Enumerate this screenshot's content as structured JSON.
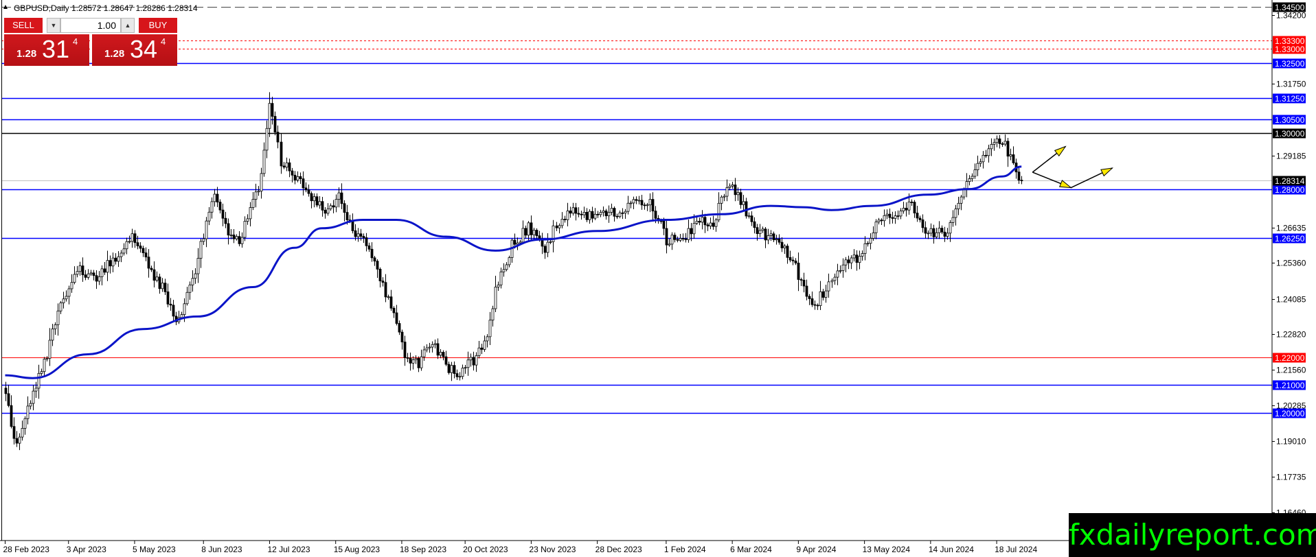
{
  "symbol_info": "GBPUSD,Daily  1.28572 1.28647 1.28286 1.28314",
  "trade_panel": {
    "sell_label": "SELL",
    "buy_label": "BUY",
    "lot_size": "1.00",
    "sell_price_small": "1.28",
    "sell_price_big": "31",
    "sell_price_sup": "4",
    "buy_price_small": "1.28",
    "buy_price_big": "34",
    "buy_price_sup": "4"
  },
  "watermark": "fxdailyreport.com",
  "colors": {
    "background": "#ffffff",
    "candle": "#000000",
    "moving_average": "#0a14c8",
    "level_blue": "#0000ff",
    "level_red": "#ff0000",
    "level_black": "#000000",
    "arrow_yellow": "#ffe800"
  },
  "chart_data": {
    "type": "candlestick",
    "symbol": "GBPUSD",
    "timeframe": "Daily",
    "ylim": [
      1.1545,
      1.3475
    ],
    "grid": false,
    "y_ticks": [
      1.342,
      1.3175,
      1.2918,
      1.2663,
      1.2536,
      1.2408,
      1.2282,
      1.2156,
      1.2028,
      1.1901,
      1.1773,
      1.1646
    ],
    "y_tick_labels": [
      "1.34200",
      "1.31750",
      "1.29185",
      "1.26635",
      "1.25360",
      "1.24085",
      "1.22820",
      "1.21560",
      "1.20285",
      "1.19010",
      "1.17735",
      "1.16460"
    ],
    "x_labels": [
      "28 Feb 2023",
      "3 Apr 2023",
      "5 May 2023",
      "8 Jun 2023",
      "12 Jul 2023",
      "15 Aug 2023",
      "18 Sep 2023",
      "20 Oct 2023",
      "23 Nov 2023",
      "28 Dec 2023",
      "1 Feb 2024",
      "6 Mar 2024",
      "9 Apr 2024",
      "13 May 2024",
      "14 Jun 2024",
      "18 Jul 2024"
    ],
    "x_label_index": [
      0,
      23,
      47,
      72,
      96,
      120,
      144,
      167,
      191,
      215,
      240,
      264,
      288,
      312,
      336,
      360
    ],
    "close_anchors": [
      [
        0,
        1.205
      ],
      [
        4,
        1.188
      ],
      [
        8,
        1.202
      ],
      [
        13,
        1.215
      ],
      [
        20,
        1.238
      ],
      [
        26,
        1.252
      ],
      [
        33,
        1.248
      ],
      [
        40,
        1.256
      ],
      [
        46,
        1.264
      ],
      [
        52,
        1.252
      ],
      [
        58,
        1.243
      ],
      [
        62,
        1.232
      ],
      [
        68,
        1.247
      ],
      [
        72,
        1.264
      ],
      [
        76,
        1.278
      ],
      [
        80,
        1.266
      ],
      [
        85,
        1.262
      ],
      [
        92,
        1.28
      ],
      [
        96,
        1.31
      ],
      [
        100,
        1.29
      ],
      [
        105,
        1.284
      ],
      [
        112,
        1.276
      ],
      [
        117,
        1.272
      ],
      [
        121,
        1.277
      ],
      [
        126,
        1.265
      ],
      [
        132,
        1.259
      ],
      [
        137,
        1.246
      ],
      [
        142,
        1.232
      ],
      [
        146,
        1.218
      ],
      [
        150,
        1.218
      ],
      [
        155,
        1.226
      ],
      [
        160,
        1.217
      ],
      [
        165,
        1.214
      ],
      [
        170,
        1.219
      ],
      [
        175,
        1.228
      ],
      [
        178,
        1.244
      ],
      [
        184,
        1.26
      ],
      [
        190,
        1.266
      ],
      [
        196,
        1.259
      ],
      [
        200,
        1.267
      ],
      [
        206,
        1.274
      ],
      [
        210,
        1.27
      ],
      [
        216,
        1.272
      ],
      [
        222,
        1.272
      ],
      [
        228,
        1.276
      ],
      [
        234,
        1.276
      ],
      [
        240,
        1.262
      ],
      [
        246,
        1.263
      ],
      [
        252,
        1.268
      ],
      [
        257,
        1.268
      ],
      [
        262,
        1.282
      ],
      [
        266,
        1.278
      ],
      [
        270,
        1.27
      ],
      [
        274,
        1.264
      ],
      [
        278,
        1.263
      ],
      [
        282,
        1.26
      ],
      [
        286,
        1.254
      ],
      [
        290,
        1.245
      ],
      [
        294,
        1.238
      ],
      [
        298,
        1.245
      ],
      [
        302,
        1.25
      ],
      [
        306,
        1.255
      ],
      [
        310,
        1.255
      ],
      [
        314,
        1.264
      ],
      [
        319,
        1.27
      ],
      [
        324,
        1.272
      ],
      [
        329,
        1.275
      ],
      [
        334,
        1.266
      ],
      [
        338,
        1.264
      ],
      [
        342,
        1.265
      ],
      [
        346,
        1.276
      ],
      [
        350,
        1.283
      ],
      [
        354,
        1.29
      ],
      [
        358,
        1.294
      ],
      [
        362,
        1.298
      ],
      [
        366,
        1.288
      ],
      [
        369,
        1.2831
      ]
    ],
    "candle_count": 370,
    "last_close": 1.28314,
    "moving_average": [
      [
        0,
        1.2135
      ],
      [
        10,
        1.2125
      ],
      [
        30,
        1.221
      ],
      [
        50,
        1.23
      ],
      [
        70,
        1.2345
      ],
      [
        90,
        1.245
      ],
      [
        105,
        1.259
      ],
      [
        115,
        1.266
      ],
      [
        130,
        1.269
      ],
      [
        142,
        1.269
      ],
      [
        160,
        1.263
      ],
      [
        178,
        1.258
      ],
      [
        195,
        1.262
      ],
      [
        215,
        1.265
      ],
      [
        240,
        1.269
      ],
      [
        260,
        1.271
      ],
      [
        278,
        1.274
      ],
      [
        290,
        1.2735
      ],
      [
        300,
        1.2725
      ],
      [
        315,
        1.274
      ],
      [
        335,
        1.278
      ],
      [
        350,
        1.28
      ],
      [
        362,
        1.2845
      ],
      [
        369,
        1.288
      ]
    ],
    "levels": [
      {
        "price": 1.345,
        "label": "1.34500",
        "style": "dashed",
        "color": "#444444"
      },
      {
        "price": 1.333,
        "label": "1.33300",
        "style": "dotted",
        "color": "#ff0000"
      },
      {
        "price": 1.33,
        "label": "1.33000",
        "style": "dotted",
        "color": "#ff0000"
      },
      {
        "price": 1.325,
        "label": "1.32500",
        "style": "solid",
        "color": "#0000ff"
      },
      {
        "price": 1.3125,
        "label": "1.31250",
        "style": "solid",
        "color": "#0000ff"
      },
      {
        "price": 1.305,
        "label": "1.30500",
        "style": "solid",
        "color": "#0000ff"
      },
      {
        "price": 1.3,
        "label": "1.30000",
        "style": "solid",
        "color": "#000000"
      },
      {
        "price": 1.28,
        "label": "1.28000",
        "style": "solid",
        "color": "#0000ff"
      },
      {
        "price": 1.2625,
        "label": "1.26250",
        "style": "solid",
        "color": "#0000ff"
      },
      {
        "price": 1.22,
        "label": "1.22000",
        "style": "solid",
        "color": "#ff0000"
      },
      {
        "price": 1.21,
        "label": "1.21000",
        "style": "solid",
        "color": "#0000ff"
      },
      {
        "price": 1.2,
        "label": "1.20000",
        "style": "solid",
        "color": "#0000ff"
      }
    ],
    "current_price_label": "1.28314",
    "arrows": [
      {
        "from": [
          373,
          1.286
        ],
        "to": [
          385,
          1.2952
        ]
      },
      {
        "from": [
          373,
          1.286
        ],
        "to": [
          387,
          1.2805
        ]
      },
      {
        "from": [
          387,
          1.2805
        ],
        "to": [
          402,
          1.2875
        ]
      }
    ]
  }
}
